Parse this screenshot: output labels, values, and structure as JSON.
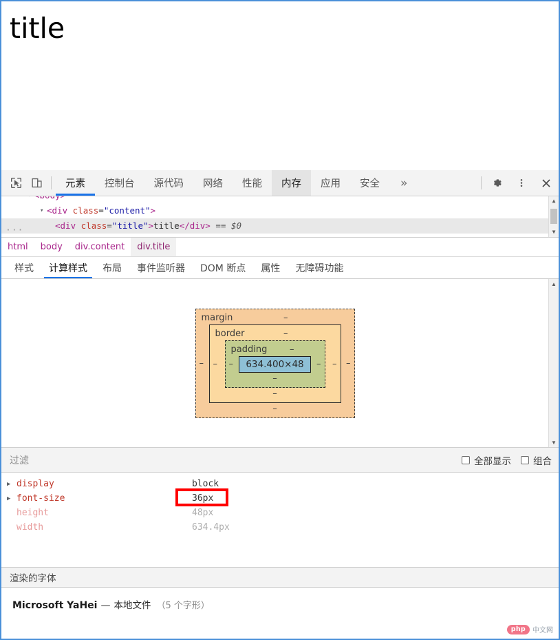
{
  "page": {
    "title_text": "title"
  },
  "devtools": {
    "toolbar": {
      "inspect_icon": "inspect-cursor-icon",
      "device_icon": "device-toolbar-icon",
      "tabs": [
        {
          "label": "元素",
          "state": "selected"
        },
        {
          "label": "控制台",
          "state": "normal"
        },
        {
          "label": "源代码",
          "state": "normal"
        },
        {
          "label": "网络",
          "state": "normal"
        },
        {
          "label": "性能",
          "state": "normal"
        },
        {
          "label": "内存",
          "state": "active-panel"
        },
        {
          "label": "应用",
          "state": "normal"
        },
        {
          "label": "安全",
          "state": "normal"
        },
        {
          "label": "»",
          "state": "chevron"
        }
      ],
      "settings_icon": "gear-icon",
      "more_icon": "kebab-menu-icon",
      "close_icon": "close-icon"
    },
    "dom_tree": {
      "lines": [
        {
          "indent": 38,
          "triangle": "▾",
          "parts": [
            {
              "t": "<body>",
              "c": "tag"
            }
          ],
          "selected": false,
          "clipped": true
        },
        {
          "indent": 56,
          "triangle": "▾",
          "parts": [
            {
              "t": "<div ",
              "c": "tag"
            },
            {
              "t": "class",
              "c": "attr"
            },
            {
              "t": "=",
              "c": "txt"
            },
            {
              "t": "\"content\"",
              "c": "val"
            },
            {
              "t": ">",
              "c": "tag"
            }
          ],
          "selected": false,
          "clipped": false
        },
        {
          "indent": 78,
          "triangle": "",
          "parts": [
            {
              "t": "<div ",
              "c": "tag"
            },
            {
              "t": "class",
              "c": "attr"
            },
            {
              "t": "=",
              "c": "txt"
            },
            {
              "t": "\"title\"",
              "c": "val"
            },
            {
              "t": ">",
              "c": "tag"
            },
            {
              "t": "title",
              "c": "txt"
            },
            {
              "t": "</div>",
              "c": "tag"
            },
            {
              "t": " == ",
              "c": "txt"
            },
            {
              "t": "$0",
              "c": "dollar"
            }
          ],
          "selected": true,
          "clipped": false
        }
      ],
      "dots_badge": "···"
    },
    "breadcrumb": [
      {
        "label": "html",
        "active": false
      },
      {
        "label": "body",
        "active": false
      },
      {
        "label": "div.content",
        "active": false
      },
      {
        "label": "div.title",
        "active": true
      }
    ],
    "sub_tabs": [
      {
        "label": "样式",
        "active": false
      },
      {
        "label": "计算样式",
        "active": true
      },
      {
        "label": "布局",
        "active": false
      },
      {
        "label": "事件监听器",
        "active": false
      },
      {
        "label": "DOM 断点",
        "active": false
      },
      {
        "label": "属性",
        "active": false
      },
      {
        "label": "无障碍功能",
        "active": false
      }
    ],
    "box_model": {
      "margin_label": "margin",
      "margin_value": "–",
      "border_label": "border",
      "border_value": "–",
      "padding_label": "padding",
      "padding_value": "–",
      "content_size": "634.400×48",
      "dash": "–",
      "colors": {
        "margin": "#f7cc9c",
        "border": "#fcd9a0",
        "padding": "#c2cd8f",
        "content": "#8ec0d6"
      }
    },
    "filter_bar": {
      "placeholder": "过滤",
      "show_all_label": "全部显示",
      "show_all_checked": false,
      "group_label": "组合",
      "group_checked": false
    },
    "computed_properties": [
      {
        "name": "display",
        "value": "block",
        "expandable": true,
        "inherited": false
      },
      {
        "name": "font-size",
        "value": "36px",
        "expandable": true,
        "inherited": false,
        "highlighted": true
      },
      {
        "name": "height",
        "value": "48px",
        "expandable": false,
        "inherited": true
      },
      {
        "name": "width",
        "value": "634.4px",
        "expandable": false,
        "inherited": true
      }
    ],
    "highlight_color": "#ff0000",
    "rendered_fonts": {
      "header": "渲染的字体",
      "font_name": "Microsoft YaHei",
      "dash": "—",
      "source": "本地文件",
      "glyphs": "（5 个字形）"
    }
  },
  "watermark": {
    "badge": "php",
    "label": "中文网"
  }
}
